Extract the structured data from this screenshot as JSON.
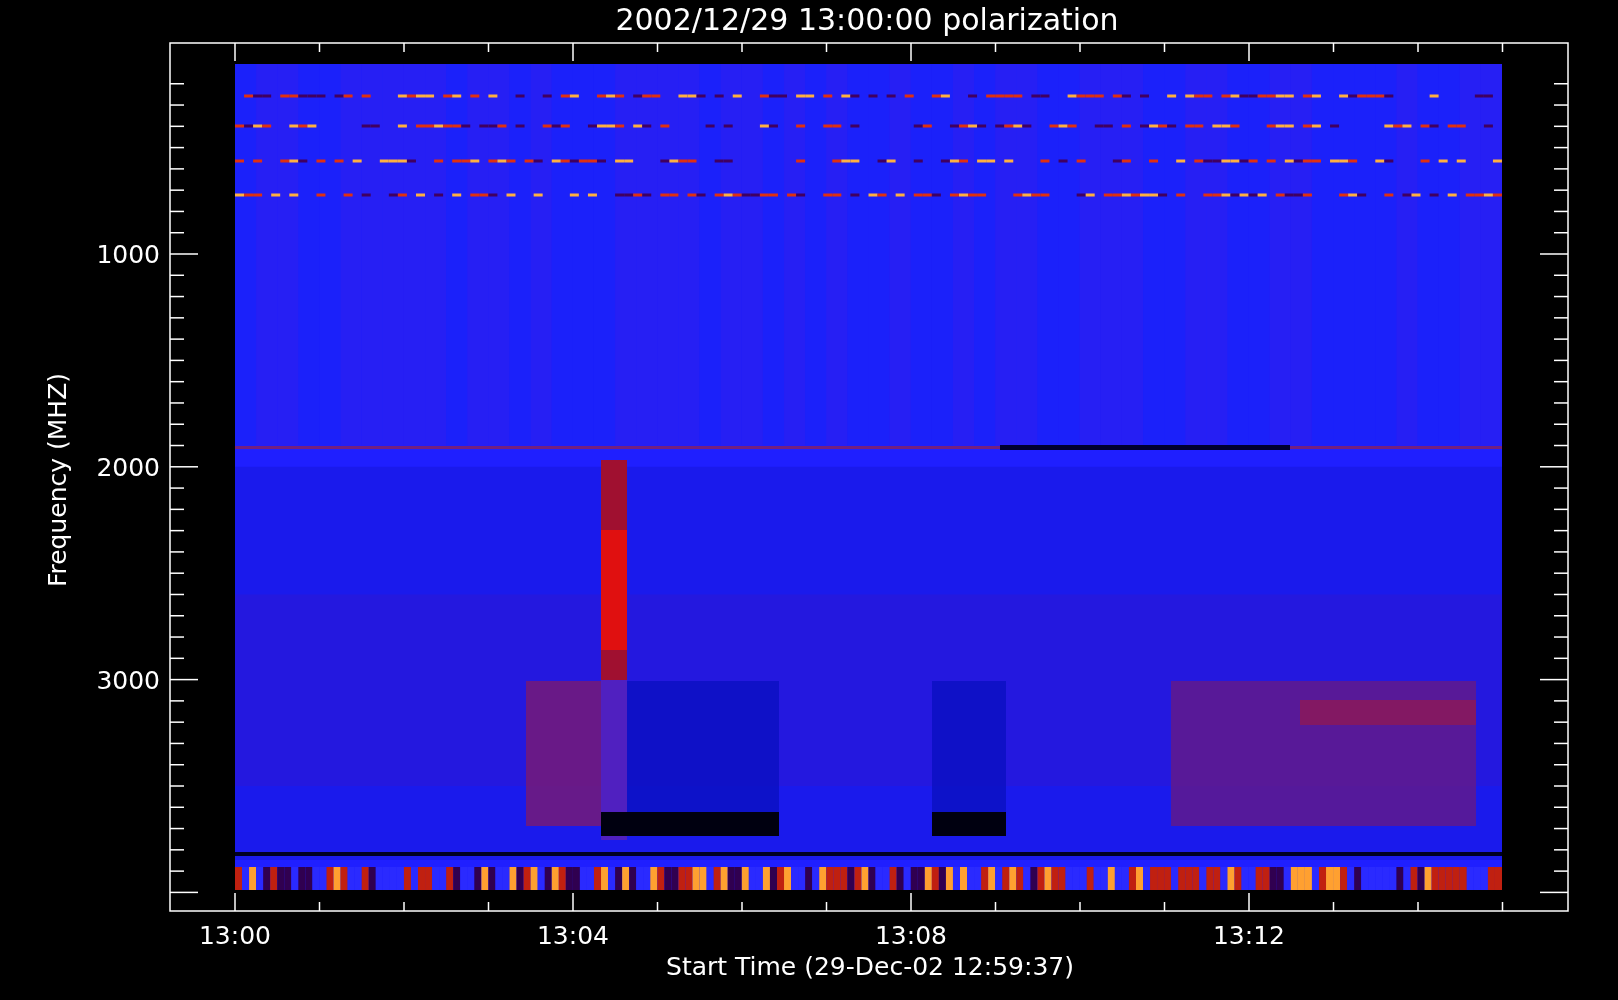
{
  "title": "2002/12/29 13:00:00 polarization",
  "x_axis": {
    "label": "Start Time (29-Dec-02 12:59:37)",
    "ticks": [
      "13:00",
      "13:04",
      "13:08",
      "13:12"
    ]
  },
  "y_axis": {
    "label": "Frequency (MHZ)",
    "ticks": [
      "1000",
      "2000",
      "3000"
    ]
  }
}
